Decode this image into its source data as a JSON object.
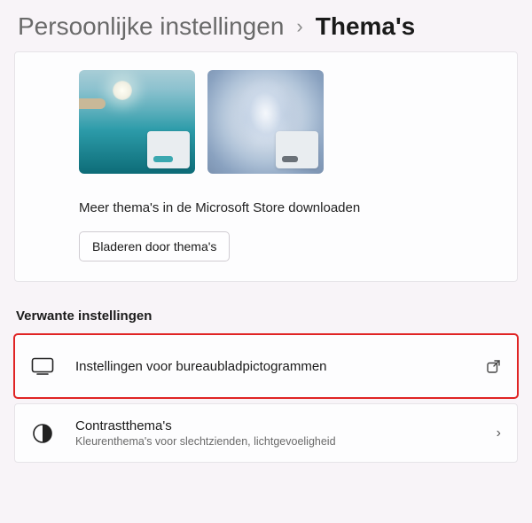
{
  "breadcrumb": {
    "parent": "Persoonlijke instellingen",
    "current": "Thema's"
  },
  "themes": {
    "store_text": "Meer thema's in de Microsoft Store downloaden",
    "browse_label": "Bladeren door thema's"
  },
  "related": {
    "heading": "Verwante instellingen",
    "desktop_icons": {
      "title": "Instellingen voor bureaubladpictogrammen"
    },
    "contrast": {
      "title": "Contrastthema's",
      "subtitle": "Kleurenthema's voor slechtzienden, lichtgevoeligheid"
    }
  }
}
